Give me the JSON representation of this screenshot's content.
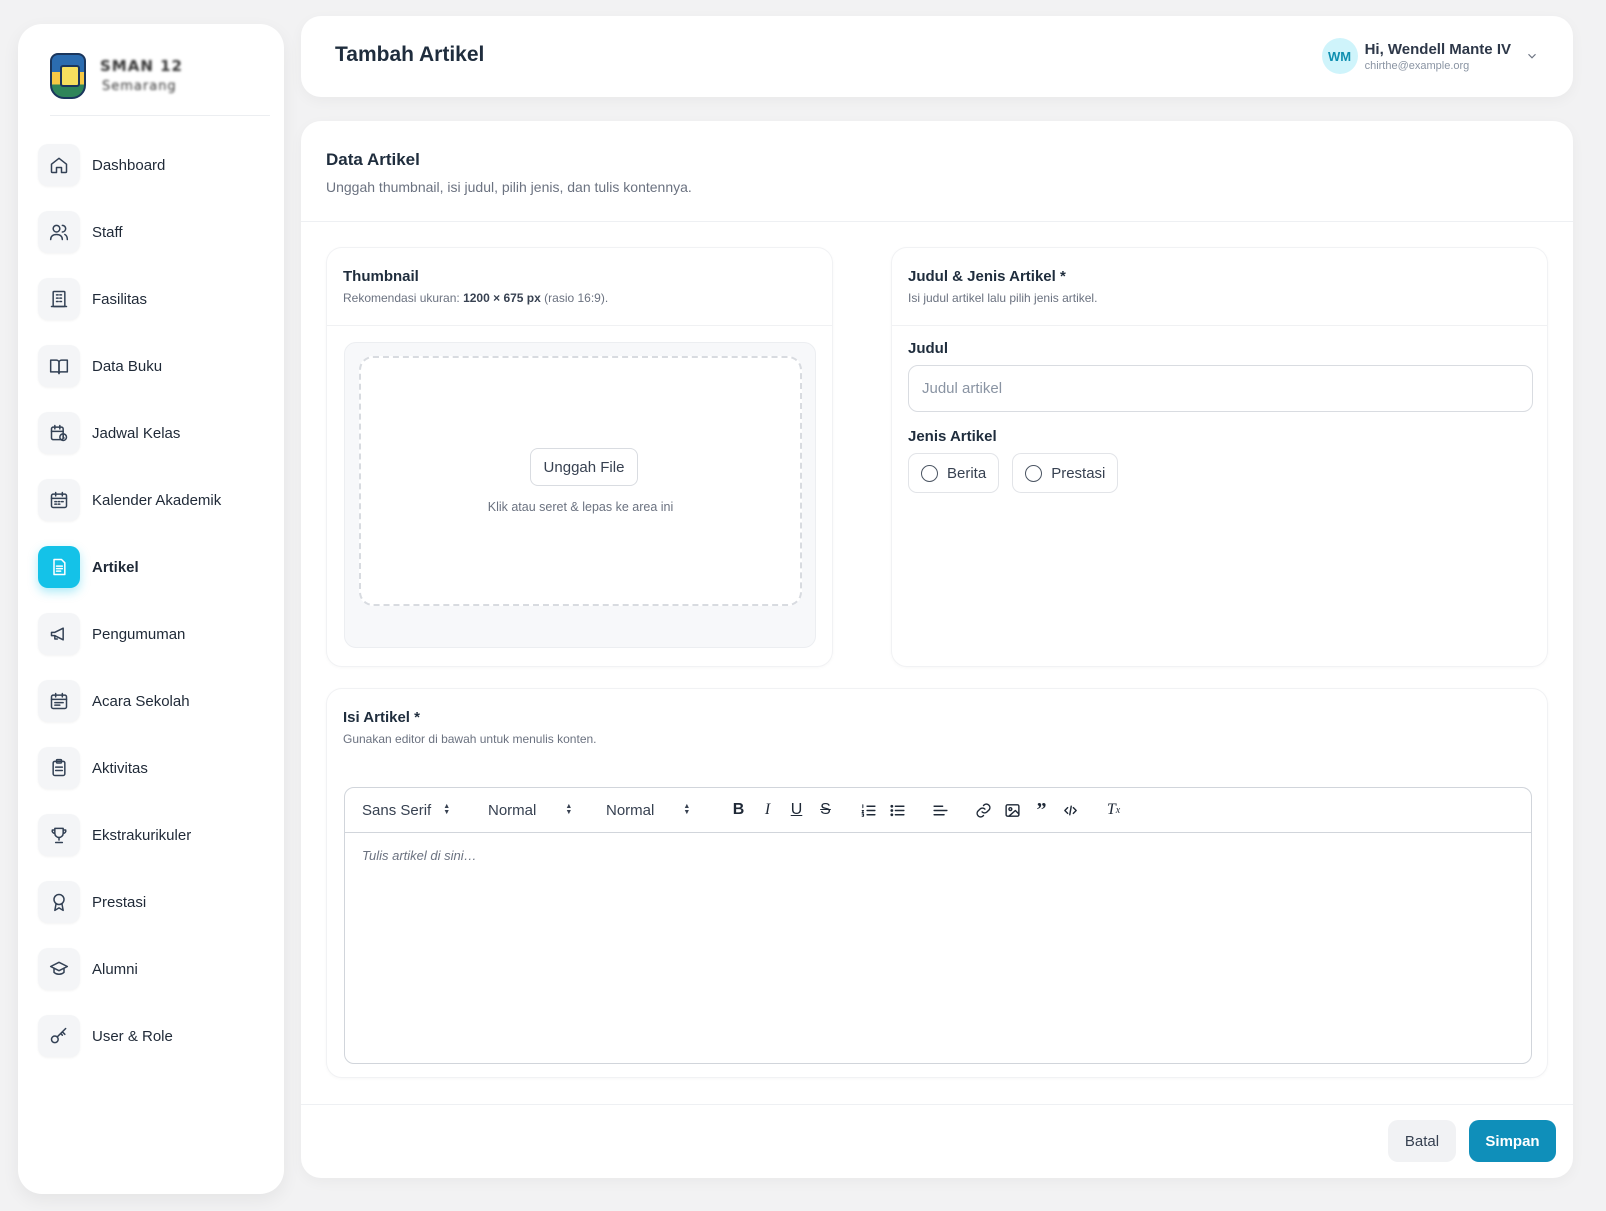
{
  "brand": {
    "line1": "SMAN 12",
    "line2": "Semarang"
  },
  "sidebar": {
    "items": [
      {
        "label": "Dashboard",
        "icon": "home-icon"
      },
      {
        "label": "Staff",
        "icon": "users-icon"
      },
      {
        "label": "Fasilitas",
        "icon": "building-icon"
      },
      {
        "label": "Data Buku",
        "icon": "book-icon"
      },
      {
        "label": "Jadwal Kelas",
        "icon": "calendar-clock-icon"
      },
      {
        "label": "Kalender Akademik",
        "icon": "calendar-icon"
      },
      {
        "label": "Artikel",
        "icon": "document-icon",
        "active": true
      },
      {
        "label": "Pengumuman",
        "icon": "megaphone-icon"
      },
      {
        "label": "Acara Sekolah",
        "icon": "calendar-event-icon"
      },
      {
        "label": "Aktivitas",
        "icon": "clipboard-icon"
      },
      {
        "label": "Ekstrakurikuler",
        "icon": "trophy-icon"
      },
      {
        "label": "Prestasi",
        "icon": "award-icon"
      },
      {
        "label": "Alumni",
        "icon": "graduation-cap-icon"
      },
      {
        "label": "User & Role",
        "icon": "key-icon"
      }
    ]
  },
  "header": {
    "title": "Tambah Artikel",
    "user": {
      "initials": "WM",
      "greeting": "Hi, Wendell Mante IV",
      "email": "chirthe@example.org"
    }
  },
  "main": {
    "title": "Data Artikel",
    "subtitle": "Unggah thumbnail, isi judul, pilih jenis, dan tulis kontennya.",
    "thumbnail": {
      "title": "Thumbnail",
      "hint_prefix": "Rekomendasi ukuran: ",
      "hint_size": "1200 × 675 px",
      "hint_suffix": " (rasio 16:9).",
      "upload_label": "Unggah File",
      "drop_hint": "Klik atau seret & lepas ke area ini"
    },
    "judul_panel": {
      "title": "Judul & Jenis Artikel *",
      "subtitle": "Isi judul artikel lalu pilih jenis artikel.",
      "judul_label": "Judul",
      "judul_placeholder": "Judul artikel",
      "jenis_label": "Jenis Artikel",
      "options": [
        "Berita",
        "Prestasi"
      ]
    },
    "isi_panel": {
      "title": "Isi Artikel *",
      "subtitle": "Gunakan editor di bawah untuk menulis konten.",
      "toolbar": {
        "font": "Sans Serif",
        "size": "Normal",
        "heading": "Normal"
      },
      "editor_placeholder": "Tulis artikel di sini…"
    },
    "actions": {
      "cancel": "Batal",
      "save": "Simpan"
    }
  },
  "colors": {
    "accent": "#14c2e8",
    "primary_button": "#0f8fba",
    "background": "#f2f2f3"
  }
}
